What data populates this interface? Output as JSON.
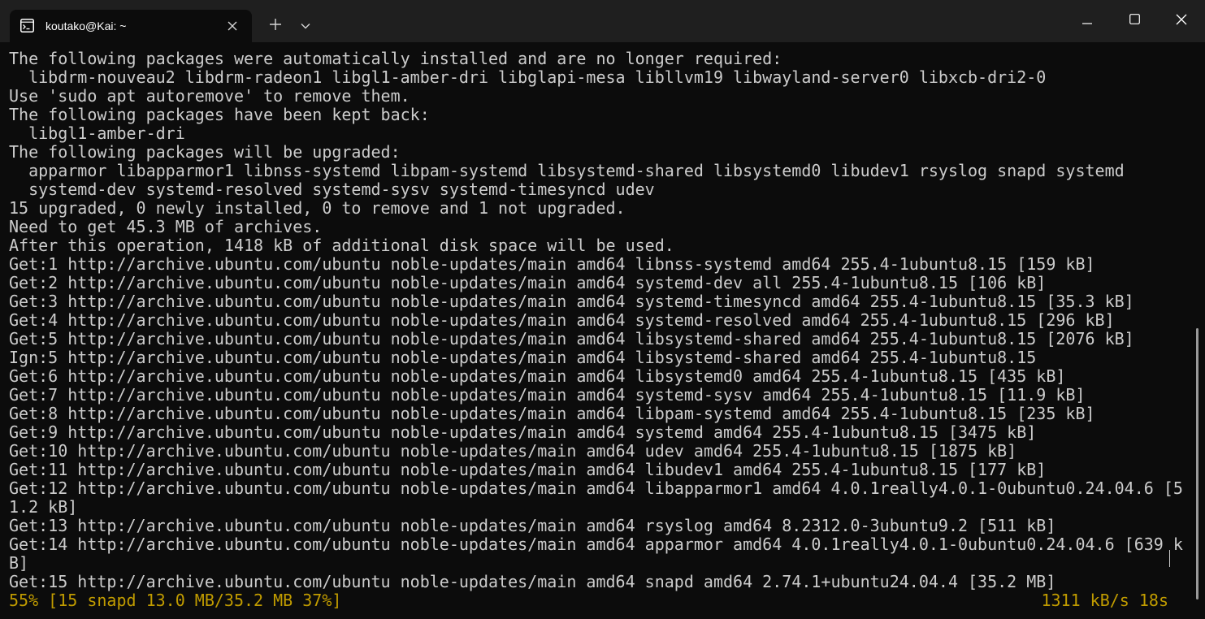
{
  "tab": {
    "title": "koutako@Kai: ~",
    "icon": "terminal-icon"
  },
  "titlebar": {
    "new_tab_icon": "plus-icon",
    "dropdown_icon": "chevron-down-icon",
    "minimize_icon": "minimize-icon",
    "maximize_icon": "maximize-icon",
    "close_icon": "close-icon"
  },
  "terminal": {
    "lines": [
      "The following packages were automatically installed and are no longer required:",
      "  libdrm-nouveau2 libdrm-radeon1 libgl1-amber-dri libglapi-mesa libllvm19 libwayland-server0 libxcb-dri2-0",
      "Use 'sudo apt autoremove' to remove them.",
      "The following packages have been kept back:",
      "  libgl1-amber-dri",
      "The following packages will be upgraded:",
      "  apparmor libapparmor1 libnss-systemd libpam-systemd libsystemd-shared libsystemd0 libudev1 rsyslog snapd systemd",
      "  systemd-dev systemd-resolved systemd-sysv systemd-timesyncd udev",
      "15 upgraded, 0 newly installed, 0 to remove and 1 not upgraded.",
      "Need to get 45.3 MB of archives.",
      "After this operation, 1418 kB of additional disk space will be used.",
      "Get:1 http://archive.ubuntu.com/ubuntu noble-updates/main amd64 libnss-systemd amd64 255.4-1ubuntu8.15 [159 kB]",
      "Get:2 http://archive.ubuntu.com/ubuntu noble-updates/main amd64 systemd-dev all 255.4-1ubuntu8.15 [106 kB]",
      "Get:3 http://archive.ubuntu.com/ubuntu noble-updates/main amd64 systemd-timesyncd amd64 255.4-1ubuntu8.15 [35.3 kB]",
      "Get:4 http://archive.ubuntu.com/ubuntu noble-updates/main amd64 systemd-resolved amd64 255.4-1ubuntu8.15 [296 kB]",
      "Get:5 http://archive.ubuntu.com/ubuntu noble-updates/main amd64 libsystemd-shared amd64 255.4-1ubuntu8.15 [2076 kB]",
      "Ign:5 http://archive.ubuntu.com/ubuntu noble-updates/main amd64 libsystemd-shared amd64 255.4-1ubuntu8.15",
      "Get:6 http://archive.ubuntu.com/ubuntu noble-updates/main amd64 libsystemd0 amd64 255.4-1ubuntu8.15 [435 kB]",
      "Get:7 http://archive.ubuntu.com/ubuntu noble-updates/main amd64 systemd-sysv amd64 255.4-1ubuntu8.15 [11.9 kB]",
      "Get:8 http://archive.ubuntu.com/ubuntu noble-updates/main amd64 libpam-systemd amd64 255.4-1ubuntu8.15 [235 kB]",
      "Get:9 http://archive.ubuntu.com/ubuntu noble-updates/main amd64 systemd amd64 255.4-1ubuntu8.15 [3475 kB]",
      "Get:10 http://archive.ubuntu.com/ubuntu noble-updates/main amd64 udev amd64 255.4-1ubuntu8.15 [1875 kB]",
      "Get:11 http://archive.ubuntu.com/ubuntu noble-updates/main amd64 libudev1 amd64 255.4-1ubuntu8.15 [177 kB]",
      "Get:12 http://archive.ubuntu.com/ubuntu noble-updates/main amd64 libapparmor1 amd64 4.0.1really4.0.1-0ubuntu0.24.04.6 [5",
      "1.2 kB]",
      "Get:13 http://archive.ubuntu.com/ubuntu noble-updates/main amd64 rsyslog amd64 8.2312.0-3ubuntu9.2 [511 kB]",
      "Get:14 http://archive.ubuntu.com/ubuntu noble-updates/main amd64 apparmor amd64 4.0.1really4.0.1-0ubuntu0.24.04.6 [639 k",
      "B]",
      "Get:15 http://archive.ubuntu.com/ubuntu noble-updates/main amd64 snapd amd64 2.74.1+ubuntu24.04.4 [35.2 MB]"
    ],
    "status_left": "55% [15 snapd 13.0 MB/35.2 MB 37%]",
    "status_right": "1311 kB/s 18s",
    "colors": {
      "background": "#0c0c0c",
      "foreground": "#cccccc",
      "status": "#c19c00",
      "titlebar": "#1f1f1f"
    }
  }
}
